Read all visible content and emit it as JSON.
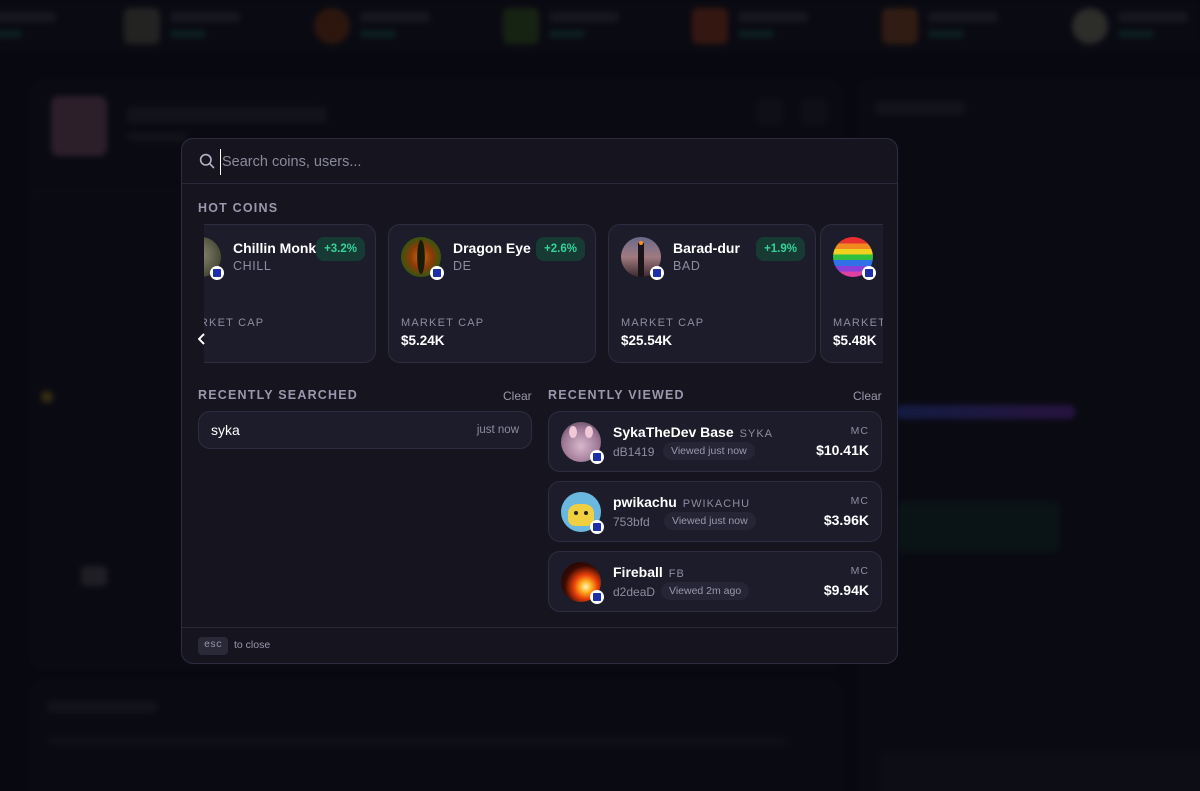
{
  "search": {
    "placeholder": "Search coins, users..."
  },
  "hot_coins": {
    "title": "HOT COINS",
    "items": [
      {
        "name": "Chillin Monkey",
        "symbol": "CHILL",
        "change": "+3.2%",
        "market_cap_label": "MARKET CAP",
        "market_cap": "",
        "image": "monkey"
      },
      {
        "name": "Dragon Eye",
        "symbol": "DE",
        "change": "+2.6%",
        "market_cap_label": "MARKET CAP",
        "market_cap": "$5.24K",
        "image": "dragon-eye"
      },
      {
        "name": "Barad-dur",
        "symbol": "BAD",
        "change": "+1.9%",
        "market_cap_label": "MARKET CAP",
        "market_cap": "$25.54K",
        "image": "tower"
      },
      {
        "name": "",
        "symbol": "",
        "change": "",
        "market_cap_label": "MARKET",
        "market_cap": "$5.48K",
        "image": "rainbow"
      }
    ]
  },
  "recently_searched": {
    "title": "RECENTLY SEARCHED",
    "clear_label": "Clear",
    "items": [
      {
        "query": "syka",
        "time": "just now"
      }
    ]
  },
  "recently_viewed": {
    "title": "RECENTLY VIEWED",
    "clear_label": "Clear",
    "items": [
      {
        "name": "SykaTheDev Base",
        "symbol": "SYKA",
        "address": "dB1419",
        "viewed": "Viewed just now",
        "mc_label": "MC",
        "market_cap": "$10.41K",
        "image": "syka"
      },
      {
        "name": "pwikachu",
        "symbol": "PWIKACHU",
        "address": "753bfd",
        "viewed": "Viewed just now",
        "mc_label": "MC",
        "market_cap": "$3.96K",
        "image": "pikachu"
      },
      {
        "name": "Fireball",
        "symbol": "FB",
        "address": "d2deaD",
        "viewed": "Viewed 2m ago",
        "mc_label": "MC",
        "market_cap": "$9.94K",
        "image": "fireball"
      }
    ]
  },
  "footer": {
    "key": "esc",
    "text": "to close"
  },
  "colors": {
    "accent_green": "#34d399",
    "modal_bg": "#16151f",
    "card_bg": "#1d1c2a",
    "chain_badge": "#1c2fa8"
  }
}
